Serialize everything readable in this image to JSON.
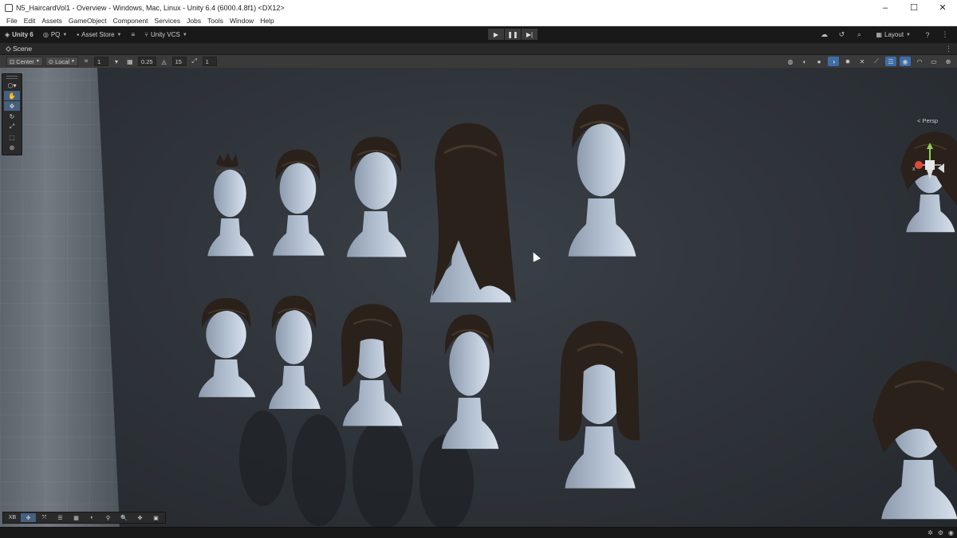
{
  "window": {
    "title": "N5_HaircardVol1 - Overview - Windows, Mac, Linux - Unity 6.4 (6000.4.8f1) <DX12>",
    "controls": [
      "–",
      "☐",
      "✕"
    ]
  },
  "menu": [
    "File",
    "Edit",
    "Assets",
    "GameObject",
    "Component",
    "Services",
    "Jobs",
    "Tools",
    "Window",
    "Help"
  ],
  "main_toolbar": {
    "unity_label": "Unity 6",
    "account": "PQ",
    "asset_store": "Asset Store",
    "vcs": "Unity VCS",
    "layout": "Layout",
    "play": "▶",
    "pause": "❚❚",
    "step": "▶|"
  },
  "scene_tab": {
    "label": "Scene"
  },
  "scene_toolbar": {
    "pivot_mode": "Center",
    "pivot_rotation": "Local",
    "grid_value": "1",
    "snap_increment": "0.25",
    "rotate_snap": "15",
    "scale_snap": "1"
  },
  "tools": [
    "hand",
    "move",
    "rotate",
    "scale",
    "rect",
    "transform"
  ],
  "gizmo": {
    "label": "< Persp",
    "axis_x": "x"
  },
  "overlay_toolbar": [
    "XB",
    "✥",
    "⤧",
    "☰",
    "▦",
    "◐",
    "⚲",
    "🔍",
    "✥",
    "▣"
  ],
  "cursor_visible": true
}
